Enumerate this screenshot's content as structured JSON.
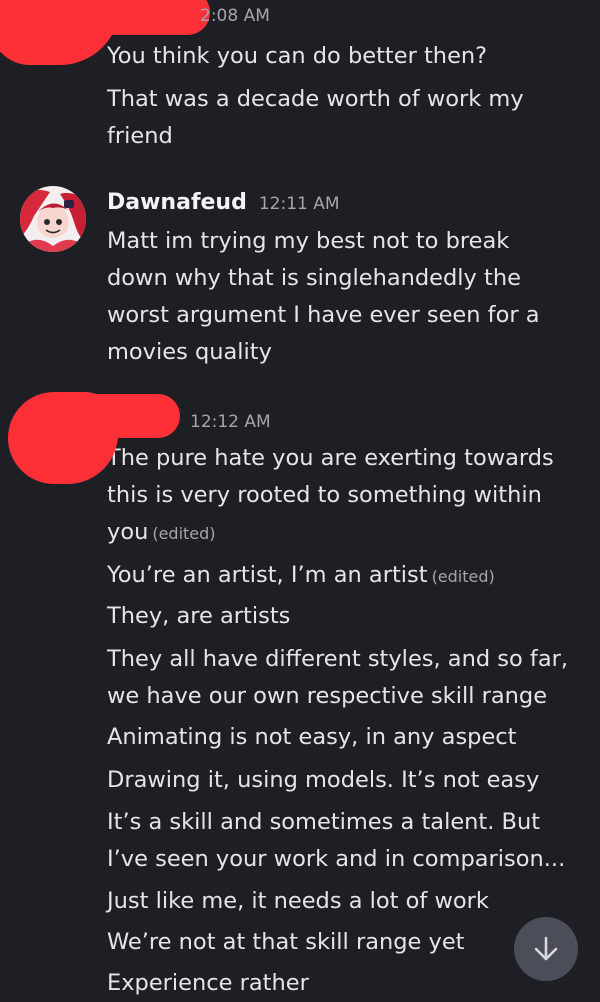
{
  "messages_top": {
    "timestamp": "2:08 AM",
    "lines": [
      "You think you can do better then?",
      "That was a decade worth of work my friend"
    ]
  },
  "messages_dawna": {
    "author": "Dawnafeud",
    "timestamp": "12:11 AM",
    "text": "Matt im trying my best not to break down why that is singlehandedly the worst argument I have ever seen for a movies quality"
  },
  "messages_bottom": {
    "timestamp": "12:12 AM",
    "lines": [
      {
        "text": "The pure hate you are exerting towards this is very rooted to something within you",
        "edited": "(edited)"
      },
      {
        "text": "You’re an artist, I’m an artist",
        "edited": "(edited)"
      },
      {
        "text": "They, are artists",
        "edited": ""
      },
      {
        "text": "They all have different styles, and so far, we have our own respective skill range",
        "edited": ""
      },
      {
        "text": "Animating is not easy, in any aspect",
        "edited": ""
      },
      {
        "text": "Drawing it, using models. It’s not easy",
        "edited": ""
      },
      {
        "text": "It’s a skill and sometimes a talent. But I’ve seen your work and in comparison...",
        "edited": ""
      },
      {
        "text": "Just like me, it needs a lot of work",
        "edited": ""
      },
      {
        "text": "We’re not at that skill range yet",
        "edited": ""
      },
      {
        "text": "Experience rather",
        "edited": ""
      }
    ]
  },
  "scroll_button": {
    "icon": "arrow-down-icon"
  },
  "colors": {
    "background": "#1e1f24",
    "text": "#e3e5e8",
    "muted": "#a3a6ad",
    "redaction": "#fd2f37",
    "scroll_button": "#4b4e58"
  }
}
